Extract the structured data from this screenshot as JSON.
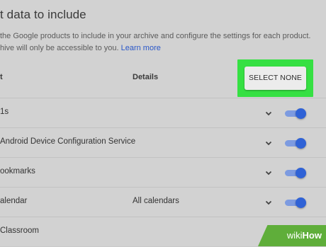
{
  "header": {
    "title": "t data to include"
  },
  "description": {
    "line1": "the Google products to include in your archive and configure the settings for each product.",
    "line2": "hive will only be accessible to you.",
    "learn_more": "Learn more"
  },
  "table": {
    "col_product": "t",
    "col_details": "Details",
    "select_none_label": "SELECT NONE"
  },
  "rows": [
    {
      "label": "1s",
      "detail": "",
      "enabled": true
    },
    {
      "label": "Android Device Configuration Service",
      "detail": "",
      "enabled": true
    },
    {
      "label": "ookmarks",
      "detail": "",
      "enabled": true
    },
    {
      "label": "alendar",
      "detail": "All calendars",
      "enabled": true
    },
    {
      "label": "Classroom",
      "detail": "",
      "enabled": true
    }
  ],
  "watermark": {
    "wiki": "wiki",
    "how": "How"
  },
  "colors": {
    "highlight": "#36e043",
    "toggle_on": "#2f62d6",
    "link": "#2a57c8",
    "watermark": "#5fae3a"
  }
}
